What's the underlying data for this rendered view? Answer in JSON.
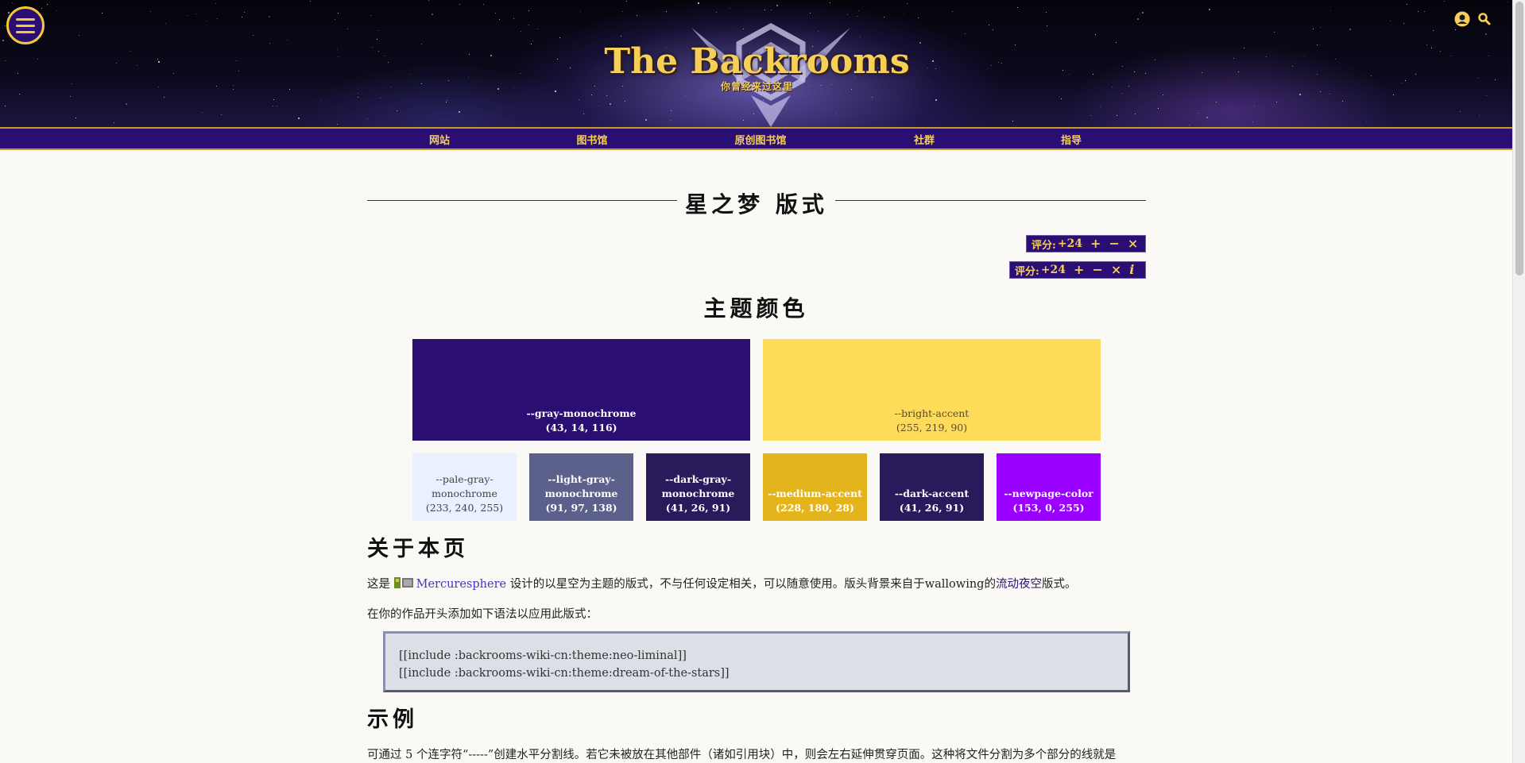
{
  "header": {
    "site_title": "The Backrooms",
    "site_subtitle": "你曾经来过这里"
  },
  "nav": {
    "items": [
      "网站",
      "图书馆",
      "原创图书馆",
      "社群",
      "指导"
    ]
  },
  "page": {
    "title": "星之梦 版式"
  },
  "rating": {
    "label": "评分:",
    "value": "+24",
    "up": "+",
    "down": "−",
    "cancel": "×",
    "info": "i"
  },
  "theme_colors": {
    "heading": "主题颜色",
    "swatches": [
      {
        "name": "--gray-monochrome",
        "rgb": "(43, 14, 116)",
        "color": "#2b0e74",
        "text_color": "#ffffff"
      },
      {
        "name": "--bright-accent",
        "rgb": "(255, 219, 90)",
        "color": "#ffdb5a",
        "text_color": "#5a4a20"
      },
      {
        "name": "--pale-gray-monochrome",
        "rgb": "(233, 240, 255)",
        "color": "#e9f0ff",
        "text_color": "#444444"
      },
      {
        "name": "--light-gray-monochrome",
        "rgb": "(91, 97, 138)",
        "color": "#5b618a",
        "text_color": "#ffffff"
      },
      {
        "name": "--dark-gray-monochrome",
        "rgb": "(41, 26, 91)",
        "color": "#291a5b",
        "text_color": "#ffffff"
      },
      {
        "name": "--medium-accent",
        "rgb": "(228, 180, 28)",
        "color": "#e4b41c",
        "text_color": "#ffffff"
      },
      {
        "name": "--dark-accent",
        "rgb": "(41, 26, 91)",
        "color": "#291a5b",
        "text_color": "#ffffff"
      },
      {
        "name": "--newpage-color",
        "rgb": "(153, 0, 255)",
        "color": "#9900ff",
        "text_color": "#ffffff"
      }
    ]
  },
  "about": {
    "heading": "关于本页",
    "p1_before": "这是",
    "author": "Mercuresphere",
    "p1_mid": "设计的以星空为主题的版式，不与任何设定相关，可以随意使用。版头背景来自于wallowing的",
    "p1_link": "流动夜空",
    "p1_after": "版式。",
    "p2": "在你的作品开头添加如下语法以应用此版式：",
    "code_line1": "[[include :backrooms-wiki-cn:theme:neo-liminal]]",
    "code_line2": "[[include :backrooms-wiki-cn:theme:dream-of-the-stars]]"
  },
  "example": {
    "heading": "示例",
    "p1": "可通过 5 个连字符“-----”创建水平分割线。若它未被放在其他部件（诸如引用块）中，则会左右延伸贯穿页面。这种将文件分割为多个部分的线就是"
  },
  "colors": {
    "brand": "#2b0e74",
    "accent": "#f6cf57",
    "link": "#4a2fc9"
  },
  "icons": {
    "menu": "hamburger-menu-icon",
    "user": "user-icon",
    "search": "search-icon"
  }
}
